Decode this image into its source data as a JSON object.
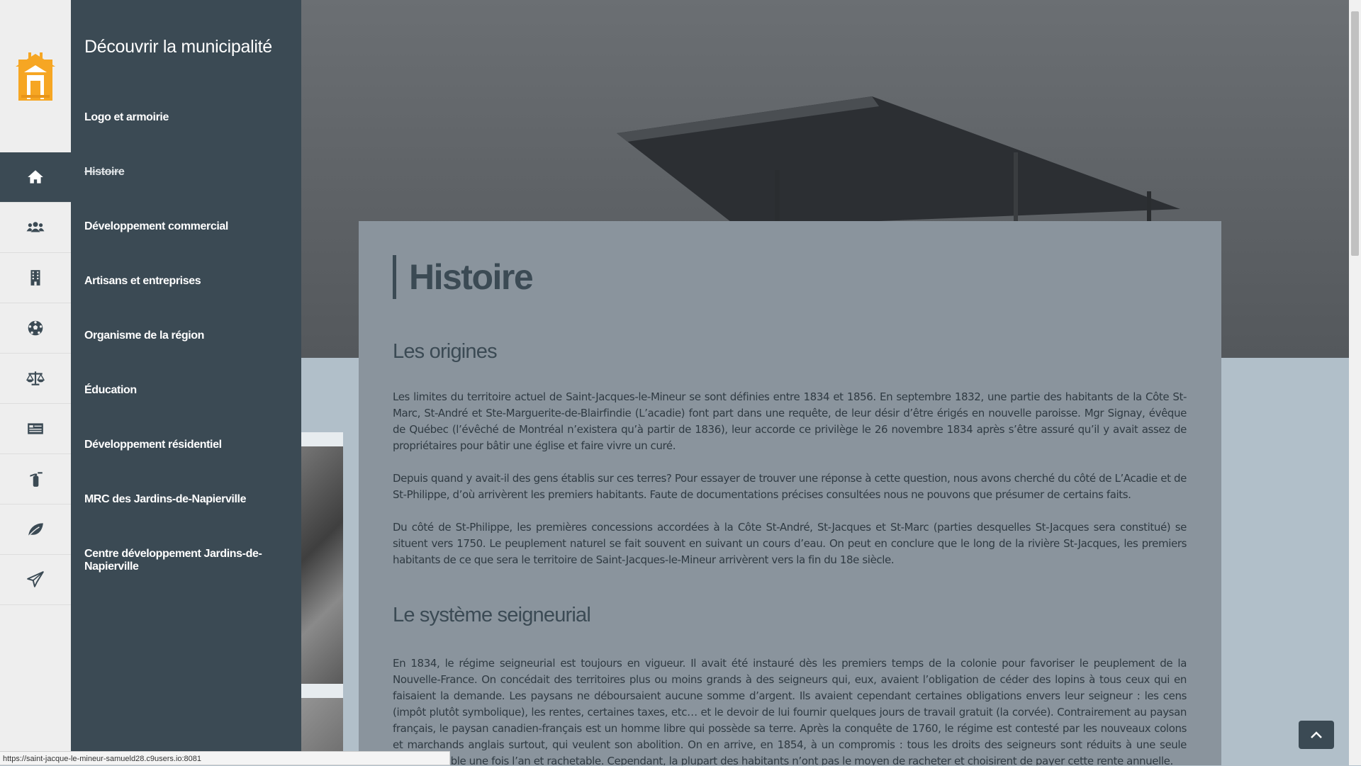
{
  "menu": {
    "title": "Découvrir la municipalité",
    "items": [
      {
        "label": "Logo et armoirie"
      },
      {
        "label": "Histoire"
      },
      {
        "label": "Développement commercial"
      },
      {
        "label": "Artisans et entreprises"
      },
      {
        "label": "Organisme de la région"
      },
      {
        "label": "Éducation"
      },
      {
        "label": "Développement résidentiel"
      },
      {
        "label": "MRC des Jardins-de-Napierville"
      },
      {
        "label": "Centre développement Jardins-de-Napierville"
      }
    ]
  },
  "rail": {
    "logo_icon": "town-hall-logo-icon",
    "icons": [
      "home-icon",
      "users-icon",
      "building-icon",
      "soccer-ball-icon",
      "scales-icon",
      "newspaper-icon",
      "fire-extinguisher-icon",
      "leaf-icon",
      "paper-plane-icon"
    ],
    "accent": "#f6a623"
  },
  "article": {
    "title": "Histoire",
    "section1": {
      "heading": "Les origines",
      "p1": "Les limites du territoire actuel de Saint-Jacques-le-Mineur se sont définies entre 1834 et 1856. En septembre 1832, une partie des habitants de la Côte St-Marc, St-André et Ste-Marguerite-de-Blairfindie (L’acadie) font part dans une requête, de leur désir d’être érigés en nouvelle paroisse. Mgr Signay, évêque de Québec (l’évêché de Montréal n’existera qu’à partir de 1836), leur accorde ce privilège le 26 novembre 1834 après s’être assuré qu’il y avait assez de propriétaires pour bâtir une église et faire vivre un curé.",
      "p2": "Depuis quand y avait-il des gens établis sur ces terres? Pour essayer de trouver une réponse à cette question, nous avons cherché du côté de L’Acadie et de St-Philippe, d’où arrivèrent les premiers habitants. Faute de documentations précises consultées nous ne pouvons que présumer de certains faits.",
      "p3": "Du côté de St-Philippe, les premières concessions accordées à la Côte St-André, St-Jacques et St-Marc (parties desquelles St-Jacques sera constitué) se situent vers 1750. Le peuplement naturel se fait souvent en suivant un cours d’eau. On peut en conclure que le long de la rivière St-Jacques, les premiers habitants de ce que sera le territoire de Saint-Jacques-le-Mineur arrivèrent vers la fin du 18e siècle."
    },
    "section2": {
      "heading": "Le système seigneurial",
      "p1": "En 1834, le régime seigneurial est toujours en vigueur. Il avait été instauré dès les premiers temps de la colonie pour favoriser le peuplement de la Nouvelle-France. On concédait des territoires plus ou moins grands à des seigneurs qui, eux, avaient l’obligation de céder des lopins à tous ceux qui en faisaient la demande. Les paysans ne déboursaient aucune somme d’argent. Ils avaient cependant certaines obligations envers leur seigneur : les cens (impôt plutôt symbolique), les rentes, certaines taxes, etc… et le devoir de lui fournir quelques jours de travail gratuit (la corvée). Contrairement au paysan français, le paysan canadien-français est un homme libre qui possède sa terre. Après la conquête de 1760, le régime est contesté par les nouveaux colons et marchands anglais surtout, qui veulent son abolition. On en arrive, en 1854, à un compromis : tous les droits des seigneurs sont réduits à une seule rente, payable une fois l’an et rachetable. Cependant, la plupart des habitants n’ont pas le moyen de racheter et choisirent de payer cette rente annuelle."
    }
  },
  "statusbar": {
    "url": "https://saint-jacque-le-mineur-samueld28.c9users.io:8081"
  }
}
